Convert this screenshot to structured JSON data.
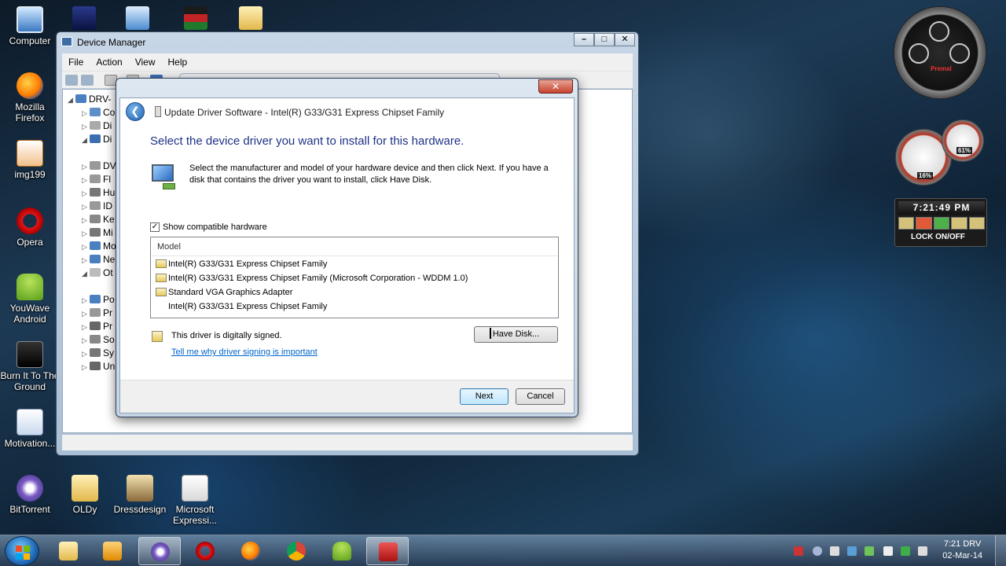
{
  "desktop_icons": [
    {
      "label": "Computer"
    },
    {
      "label": "Mozilla Firefox"
    },
    {
      "label": "img199"
    },
    {
      "label": "Opera"
    },
    {
      "label": "YouWave Android"
    },
    {
      "label": "Burn It To The Ground"
    },
    {
      "label": "Motivation..."
    },
    {
      "label": "BitTorrent"
    },
    {
      "label": "OLDy"
    },
    {
      "label": "Dressdesign"
    },
    {
      "label": "Microsoft Expressi..."
    }
  ],
  "device_manager": {
    "title": "Device Manager",
    "menu": [
      "File",
      "Action",
      "View",
      "Help"
    ],
    "tree_root": "DRV-",
    "tree_letters": [
      "Co",
      "Di",
      "Di",
      "DV",
      "Fl",
      "Hu",
      "ID",
      "Ke",
      "Mi",
      "Mo",
      "Ne",
      "Ot",
      "Po",
      "Pr",
      "Pr",
      "So",
      "Sy",
      "Un"
    ]
  },
  "update_driver": {
    "title": "Update Driver Software - Intel(R) G33/G31 Express Chipset Family",
    "close_symbol": "✕",
    "heading": "Select the device driver you want to install for this hardware.",
    "instructions": "Select the manufacturer and model of your hardware device and then click Next. If you have a disk that contains the driver you want to install, click Have Disk.",
    "show_compatible_label": "Show compatible hardware",
    "show_compatible_checked": true,
    "model_header": "Model",
    "models": [
      "Intel(R) G33/G31 Express Chipset Family",
      "Intel(R) G33/G31 Express Chipset Family (Microsoft Corporation - WDDM 1.0)",
      "Standard VGA Graphics Adapter",
      "Intel(R) G33/G31 Express Chipset Family"
    ],
    "signed_text": "This driver is digitally signed.",
    "signing_link": "Tell me why driver signing is important",
    "have_disk_label": "Have Disk...",
    "next_label": "Next",
    "cancel_label": "Cancel"
  },
  "gadgets": {
    "clock_brand": "Premal",
    "cpu_percent": "16%",
    "mem_percent": "61%",
    "time": "7:21:49 PM",
    "lock_label": "LOCK ON/OFF"
  },
  "taskbar": {
    "time": "7:21 DRV",
    "date": "02-Mar-14"
  },
  "colors": {
    "heading_blue": "#1e3287",
    "link_blue": "#0066cc",
    "close_red": "#c7432c"
  }
}
